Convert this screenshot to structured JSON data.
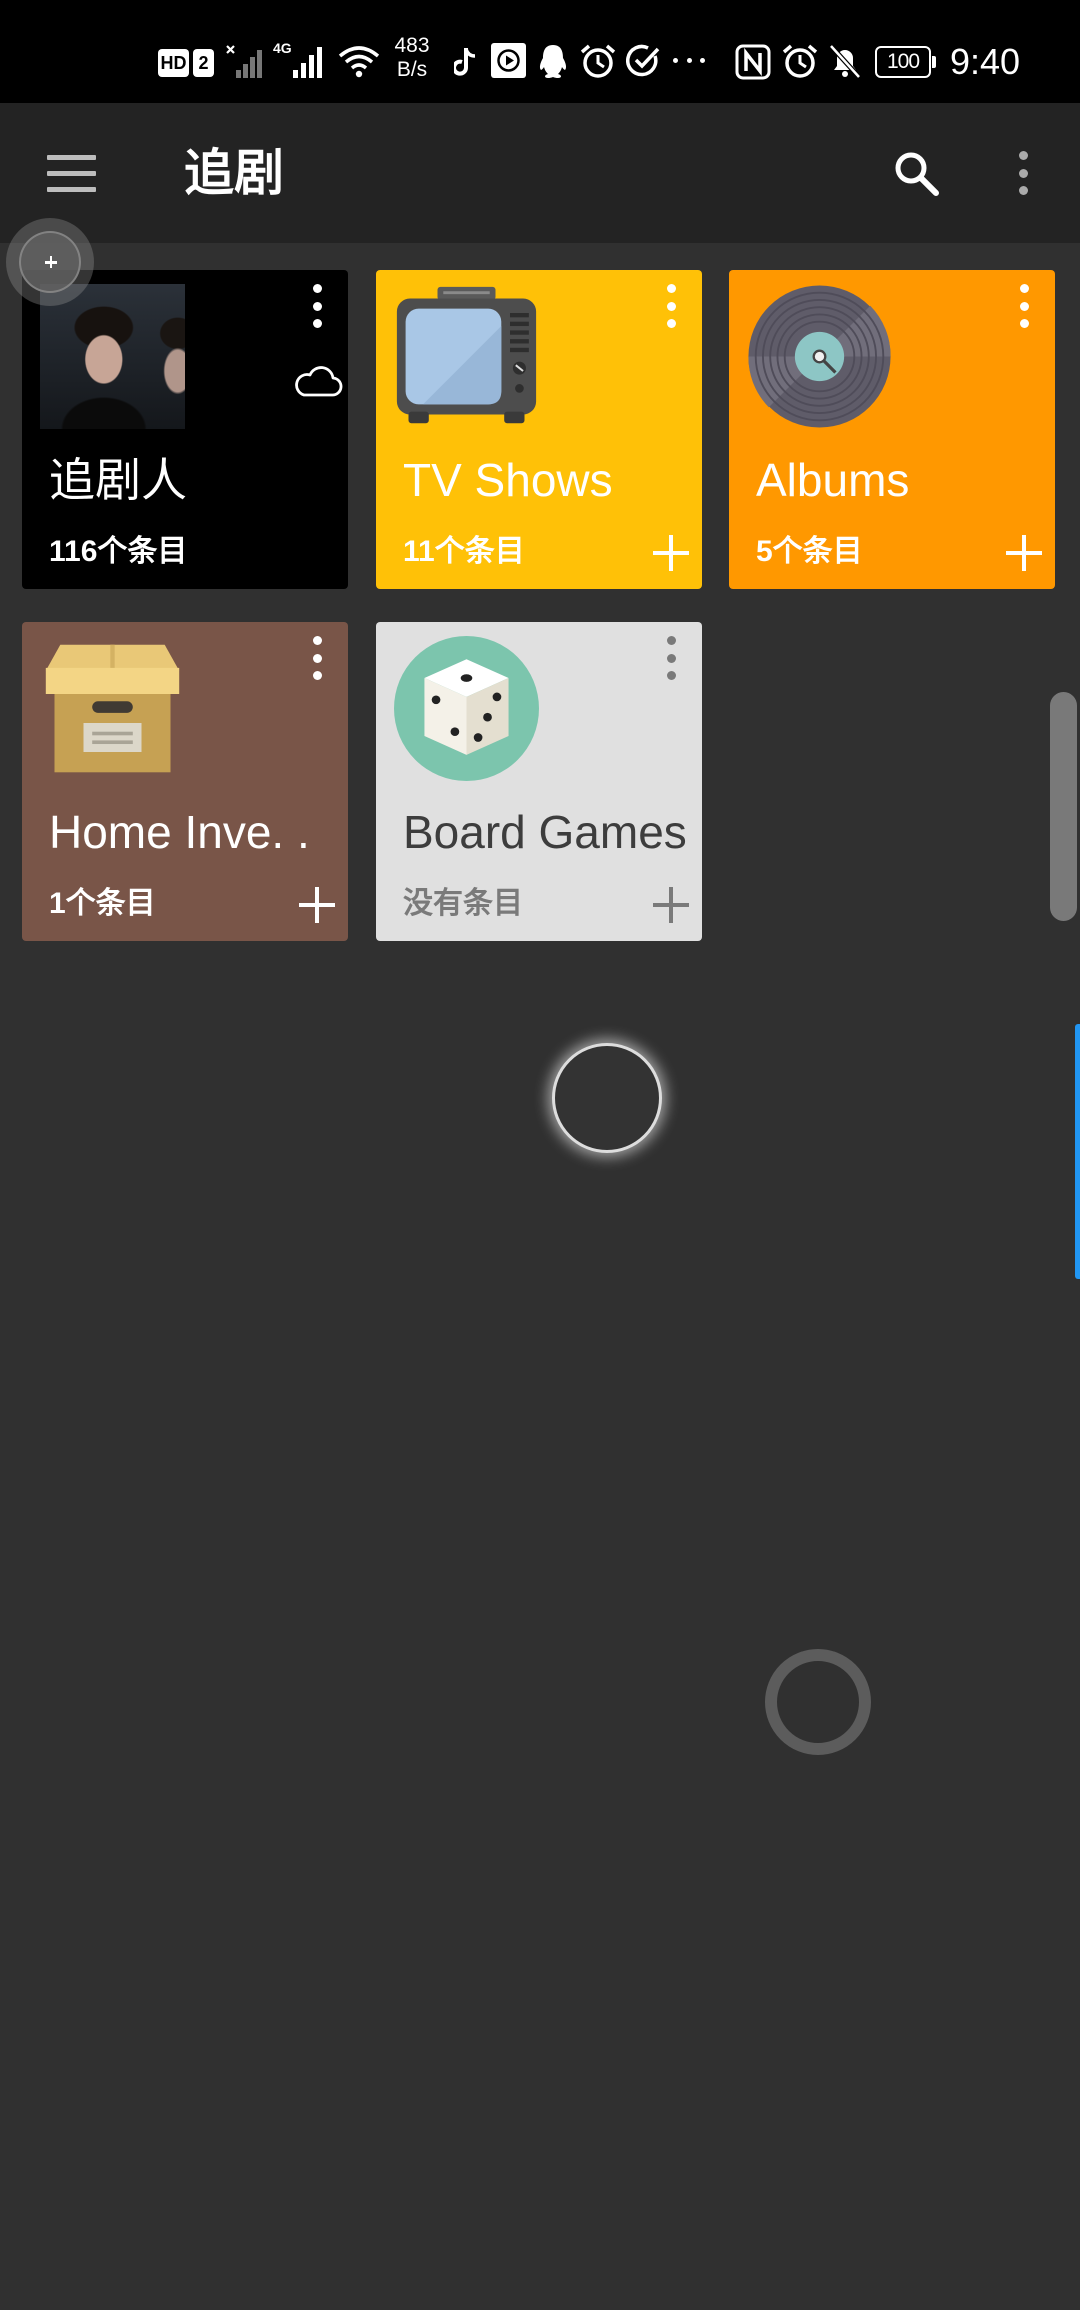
{
  "status_bar": {
    "hd_badge": "HD",
    "sim_badge": "2",
    "network_type": "4G",
    "net_speed_value": "483",
    "net_speed_unit": "B/s",
    "battery_level": "100",
    "time": "9:40",
    "icons": [
      "signal-no-service-icon",
      "signal-4g-icon",
      "wifi-icon",
      "tiktok-icon",
      "video-player-icon",
      "qq-icon",
      "alarm-clock-icon",
      "task-check-icon",
      "more-notifications-icon",
      "nfc-icon",
      "alarm-icon",
      "mute-bell-icon",
      "battery-icon"
    ]
  },
  "app_bar": {
    "title": "追剧",
    "menu_icon": "menu-icon",
    "search_icon": "search-icon",
    "overflow_icon": "more-vert-icon"
  },
  "floating_button": {
    "icon": "plus-icon"
  },
  "collections": [
    {
      "title": "追剧人",
      "count": "116个条目",
      "color": "#000000",
      "icon": "cover-photo",
      "sync_icon": "cloud-icon",
      "has_add": false
    },
    {
      "title": "TV Shows",
      "count": "11个条目",
      "color": "#FFC107",
      "icon": "tv-icon",
      "has_add": true
    },
    {
      "title": "Albums",
      "count": "5个条目",
      "color": "#FF9800",
      "icon": "vinyl-record-icon",
      "has_add": true
    },
    {
      "title": "Home Inve. .",
      "count": "1个条目",
      "color": "#795548",
      "icon": "cardboard-box-icon",
      "has_add": true
    },
    {
      "title": "Board Games",
      "count": "没有条目",
      "color": "#E0E0E0",
      "icon": "dice-icon",
      "has_add": true
    }
  ],
  "colors": {
    "status_bar": "#000000",
    "app_bar": "#232323",
    "background": "#303030",
    "edge_accent": "#2196F3"
  }
}
